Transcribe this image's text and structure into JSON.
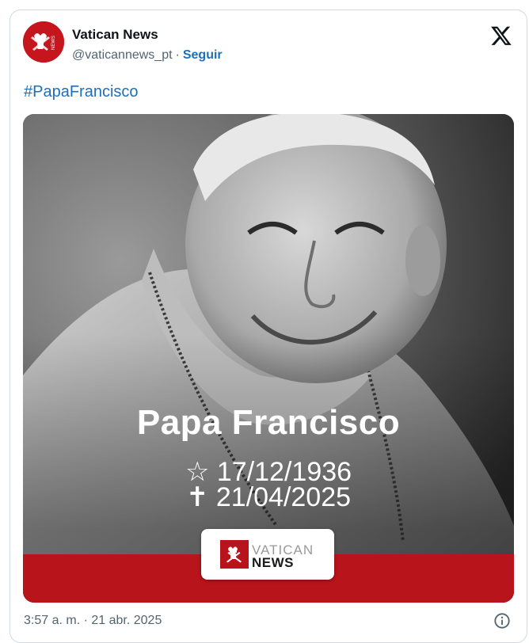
{
  "author": {
    "name": "Vatican News",
    "handle": "@vaticannews_pt",
    "separator": "·",
    "follow_label": "Seguir",
    "avatar_icon": "vatican-news-logo-icon"
  },
  "tweet": {
    "hashtag": "#PapaFrancisco",
    "timestamp": "3:57 a. m. · 21 abr. 2025"
  },
  "media": {
    "title": "Papa Francisco",
    "birth": "☆ 17/12/1936",
    "death": "✝ 21/04/2025",
    "logo_top": "VATICAN",
    "logo_bottom": "NEWS"
  },
  "icons": {
    "platform": "x-logo-icon",
    "info": "info-icon"
  },
  "colors": {
    "brand_red": "#b8141b",
    "link_blue": "#1d6fb8",
    "secondary_text": "#536471"
  }
}
